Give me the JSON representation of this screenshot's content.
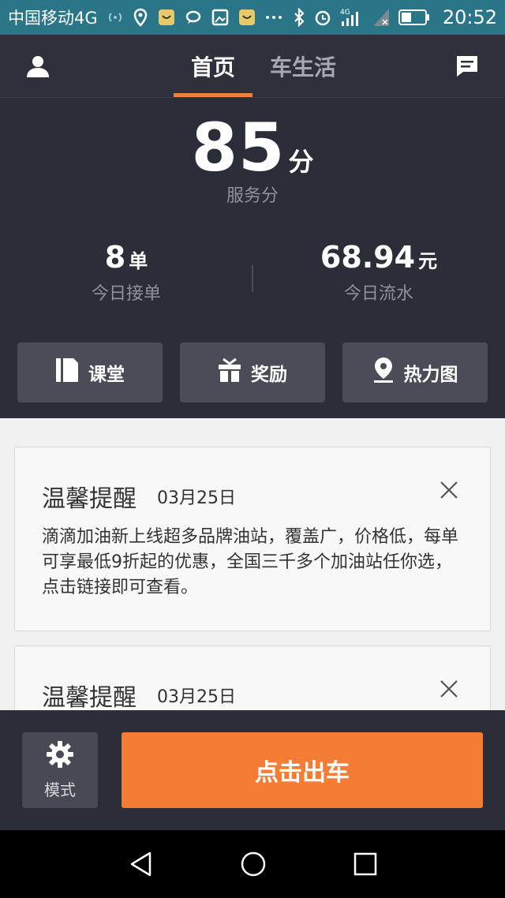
{
  "status_bar": {
    "carrier": "中国移动4G",
    "network": "4G",
    "time": "20:52",
    "icons": [
      "hotspot-icon",
      "location-icon",
      "app-icon",
      "chat-icon",
      "gallery-icon",
      "app-icon",
      "more-icon",
      "bluetooth-icon",
      "alarm-icon",
      "signal-icon",
      "signal-icon",
      "battery-icon"
    ]
  },
  "header": {
    "tabs": [
      {
        "label": "首页",
        "active": true
      },
      {
        "label": "车生活",
        "active": false
      }
    ],
    "left_icon": "profile-icon",
    "right_icon": "message-icon"
  },
  "stats": {
    "score": "85",
    "score_unit": "分",
    "score_label": "服务分",
    "orders_value": "8",
    "orders_unit": "单",
    "orders_label": "今日接单",
    "revenue_value": "68.94",
    "revenue_unit": "元",
    "revenue_label": "今日流水"
  },
  "quick_actions": [
    {
      "label": "课堂",
      "icon": "book-icon"
    },
    {
      "label": "奖励",
      "icon": "gift-icon"
    },
    {
      "label": "热力图",
      "icon": "map-pin-icon"
    }
  ],
  "notices": [
    {
      "title": "温馨提醒",
      "date": "03月25日",
      "body": "滴滴加油新上线超多品牌油站，覆盖广，价格低，每单可享最低9折起的优惠，全国三千多个加油站任你选，点击链接即可查看。"
    },
    {
      "title": "温馨提醒",
      "date": "03月25日",
      "body": ""
    }
  ],
  "action_bar": {
    "mode_label": "模式",
    "go_label": "点击出车"
  },
  "colors": {
    "accent": "#f47c35",
    "background_dark": "#2b2e38",
    "status_bar": "#2a7587"
  }
}
